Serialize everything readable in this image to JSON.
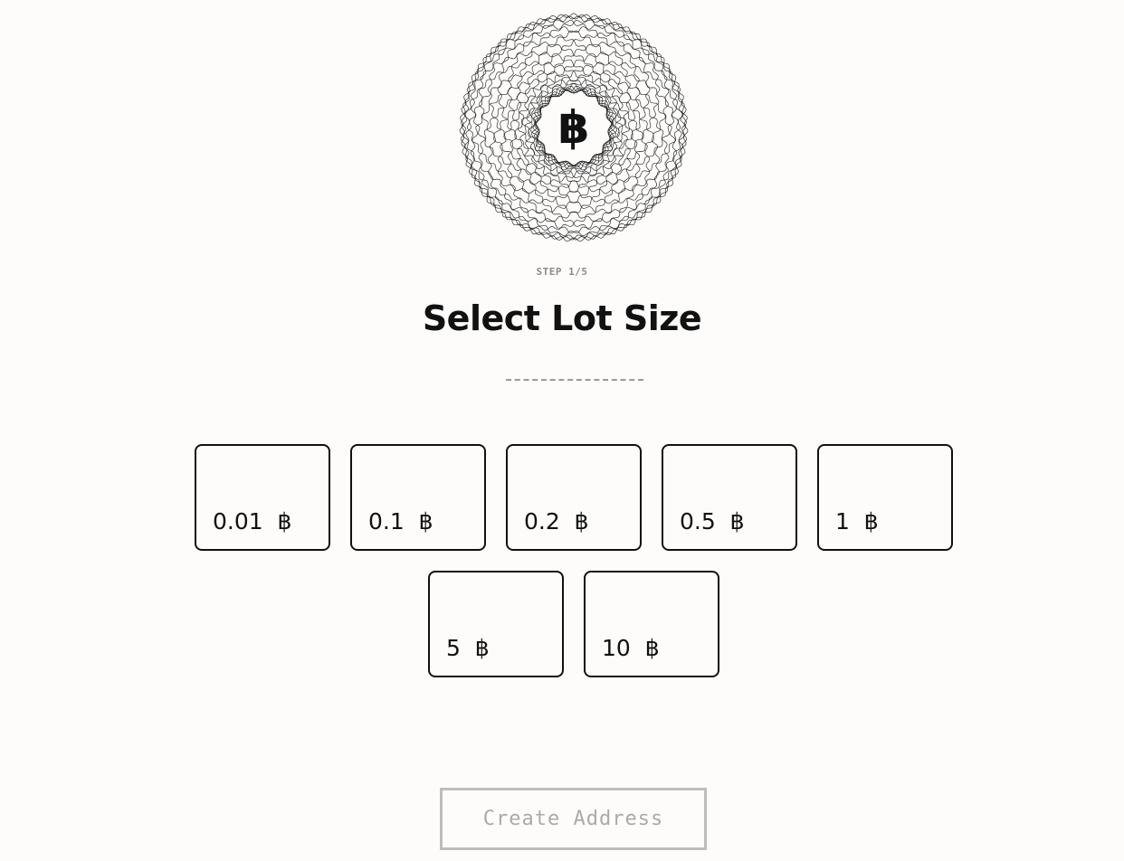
{
  "logo": {
    "symbol": "฿",
    "icon": "bitcoin-spirograph-icon"
  },
  "step": {
    "label": "STEP 1/5"
  },
  "heading": {
    "title": "Select Lot Size"
  },
  "lots": [
    {
      "label": "0.01  ฿"
    },
    {
      "label": "0.1  ฿"
    },
    {
      "label": "0.2  ฿"
    },
    {
      "label": "0.5  ฿"
    },
    {
      "label": "1  ฿"
    },
    {
      "label": "5  ฿"
    },
    {
      "label": "10  ฿"
    }
  ],
  "actions": {
    "create_label": "Create Address",
    "create_enabled": false
  },
  "colors": {
    "background": "#fdfcfb",
    "ink": "#111111",
    "muted": "#8a8a8a",
    "disabled_border": "#bdbdbd",
    "disabled_text": "#aaaaaa"
  }
}
